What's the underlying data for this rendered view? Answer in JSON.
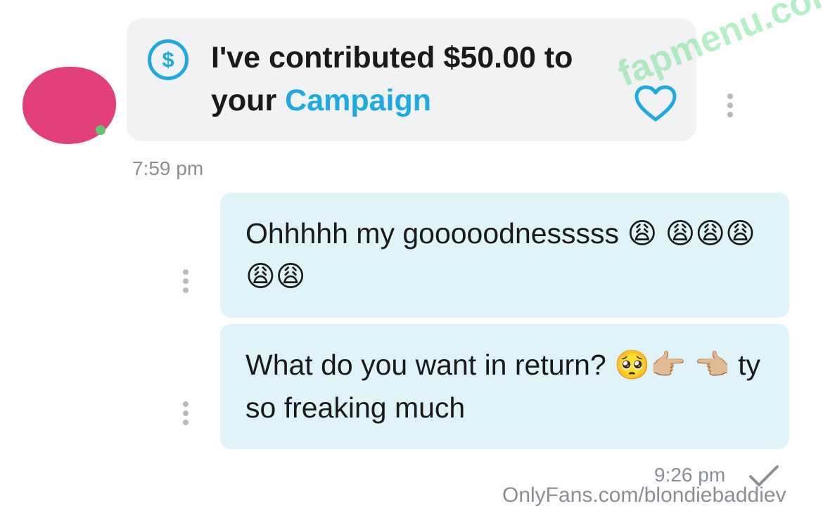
{
  "tip": {
    "text_pre": "I've contributed $50.00 to",
    "text_your": "your",
    "link_label": "Campaign",
    "icon_glyph": "$",
    "timestamp": "7:59 pm"
  },
  "messages": [
    {
      "text": "Ohhhhh my gooooodnesssss 😩 😩😩😩😩😩"
    },
    {
      "text": "What do you want in return? 🥺👉🏼 👈🏼 ty so freaking much"
    }
  ],
  "reply_meta": {
    "timestamp": "9:26 pm"
  },
  "watermark": "OnlyFans.com/blondiebaddiev",
  "overlay_watermark": "fapmenu.com",
  "colors": {
    "accent": "#1fa9e1",
    "bubble_received": "#f0f2f4",
    "bubble_sent": "#dff3f9",
    "avatar_blur": "#e23f7a"
  },
  "icons": [
    "dollar-icon",
    "heart-icon",
    "more-dots-icon",
    "checkmark-icon"
  ]
}
